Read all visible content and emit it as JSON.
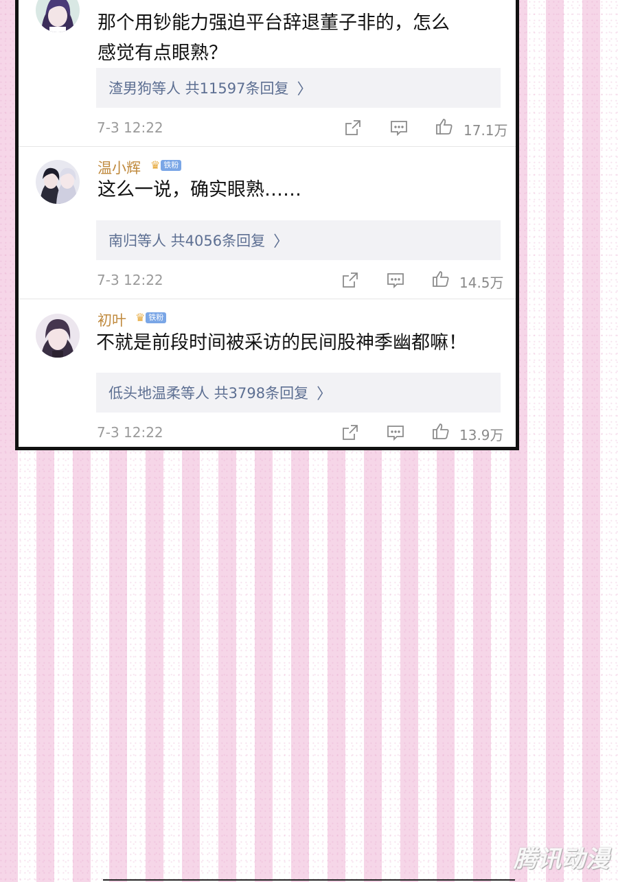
{
  "comments": [
    {
      "username": "",
      "text_lines": [
        "那个用钞能力强迫平台辞退董子非的，怎么",
        "感觉有点眼熟？"
      ],
      "replies": "渣男狗等人  共11597条回复",
      "time": "7-3 12:22",
      "likes": "17.1万"
    },
    {
      "username": "温小辉",
      "badge": "铁粉",
      "text_lines": [
        "这么一说，确实眼熟……"
      ],
      "replies": "南归等人  共4056条回复",
      "time": "7-3 12:22",
      "likes": "14.5万"
    },
    {
      "username": "初叶",
      "badge": "铁粉",
      "text_lines": [
        "不就是前段时间被采访的民间股神季幽都嘛！"
      ],
      "replies": "低头地温柔等人  共3798条回复",
      "time": "7-3 12:22",
      "likes": "13.9万"
    }
  ],
  "icons": {
    "share": "share-icon",
    "comment": "comment-icon",
    "like": "like-icon",
    "chevron": "chevron-right-icon",
    "crown": "crown-icon"
  },
  "glyphs": {
    "chevron": "〉",
    "crown": "♛"
  },
  "watermark": "腾讯动漫",
  "colors": {
    "username": "#c08a3e",
    "reply_text": "#5d6f92",
    "badge": "#7aa6e6",
    "stripe": "#f6d6e8"
  }
}
